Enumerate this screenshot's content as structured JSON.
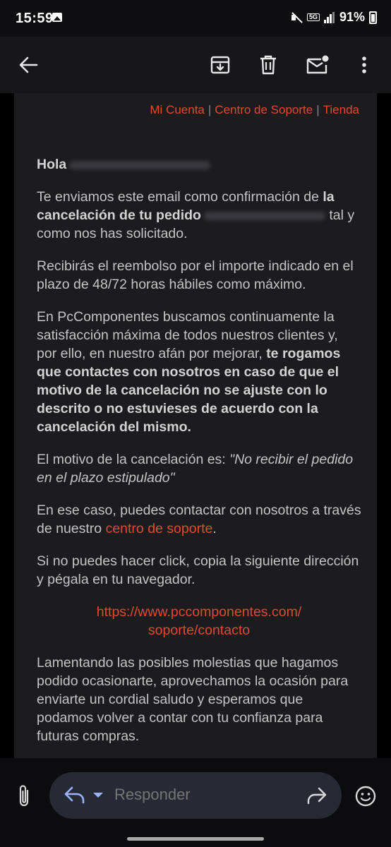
{
  "status_bar": {
    "time": "15:59",
    "network": "5G",
    "battery": "91%"
  },
  "app_bar": {
    "icons": [
      "back-arrow-icon",
      "archive-icon",
      "trash-icon",
      "mark-unread-icon",
      "more-vert-icon"
    ]
  },
  "email": {
    "top_links": {
      "account": "Mi Cuenta",
      "sep": "|",
      "support": "Centro de Soporte",
      "store": "Tienda"
    },
    "greeting": "Hola",
    "p1_a": "Te enviamos este email como confirmación de ",
    "p1_bold": "la cancelación de tu pedido",
    "p1_b": "tal y como nos has solicitado.",
    "p2": "Recibirás el reembolso por el importe indicado en el plazo de 48/72 horas hábiles como máximo.",
    "p3_a": "En PcComponentes buscamos continuamente la satisfacción máxima de todos nuestros clientes y, por ello, en nuestro afán por mejorar, ",
    "p3_bold": "te rogamos que contactes con nosotros en caso de que el motivo de la cancelación no se ajuste con lo descrito o no estuvieses de acuerdo con la cancelación del mismo.",
    "p4_a": "El motivo de la cancelación es: ",
    "p4_italic": "\"No recibir el pedido en el plazo estipulado\"",
    "p5_a": "En ese caso, puedes contactar con nosotros a través de nuestro ",
    "p5_link": "centro de soporte",
    "p5_b": ".",
    "p6": "Si no puedes hacer click, copia la siguiente dirección y pégala en tu navegador.",
    "url_line1": "https://www.pccomponentes.com/",
    "url_line2": "soporte/contacto",
    "p7": "Lamentando las posibles molestias que hagamos podido ocasionarte, aprovechamos la ocasión para enviarte un cordial saludo y esperamos que podamos volver a contar con tu confianza para futuras compras."
  },
  "reply_bar": {
    "placeholder": "Responder"
  },
  "colors": {
    "accent": "#e2492e",
    "reply_icon": "#9bb2ff",
    "pill": "#262a35"
  }
}
